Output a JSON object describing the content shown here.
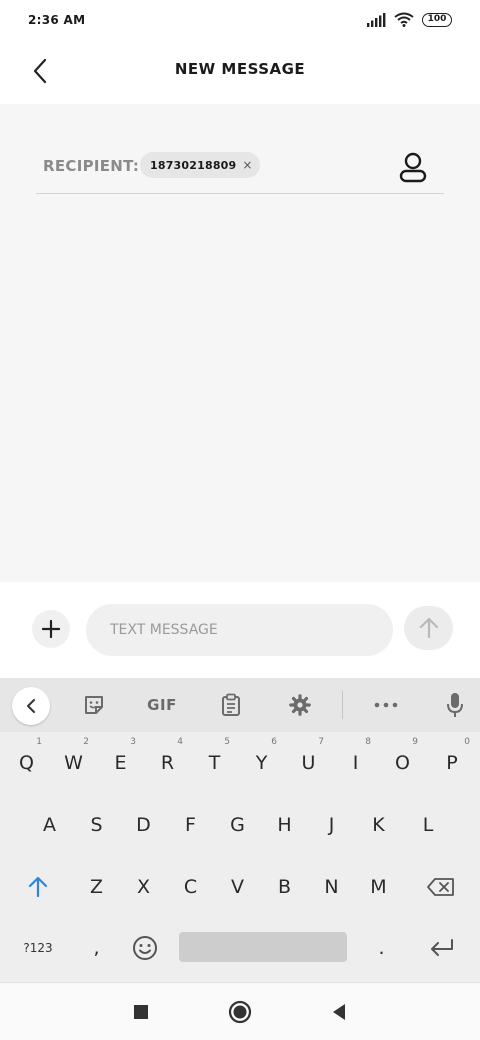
{
  "status_bar": {
    "time": "2:36 AM",
    "battery": "100"
  },
  "header": {
    "title": "NEW MESSAGE"
  },
  "recipient": {
    "label": "RECIPIENT:",
    "chip_value": "18730218809",
    "chip_close": "×"
  },
  "compose": {
    "placeholder": "TEXT MESSAGE"
  },
  "keyboard": {
    "toolbar": {
      "gif_label": "GIF"
    },
    "row1": [
      {
        "key": "Q",
        "hint": "1"
      },
      {
        "key": "W",
        "hint": "2"
      },
      {
        "key": "E",
        "hint": "3"
      },
      {
        "key": "R",
        "hint": "4"
      },
      {
        "key": "T",
        "hint": "5"
      },
      {
        "key": "Y",
        "hint": "6"
      },
      {
        "key": "U",
        "hint": "7"
      },
      {
        "key": "I",
        "hint": "8"
      },
      {
        "key": "O",
        "hint": "9"
      },
      {
        "key": "P",
        "hint": "0"
      }
    ],
    "row2": [
      "A",
      "S",
      "D",
      "F",
      "G",
      "H",
      "J",
      "K",
      "L"
    ],
    "row3": [
      "Z",
      "X",
      "C",
      "V",
      "B",
      "N",
      "M"
    ],
    "row4": {
      "symbols": "?123",
      "comma": ",",
      "period": "."
    }
  },
  "colors": {
    "accent": "#2f86d8",
    "content_bg": "#f6f6f6",
    "keyboard_bg": "#eeeeee"
  }
}
